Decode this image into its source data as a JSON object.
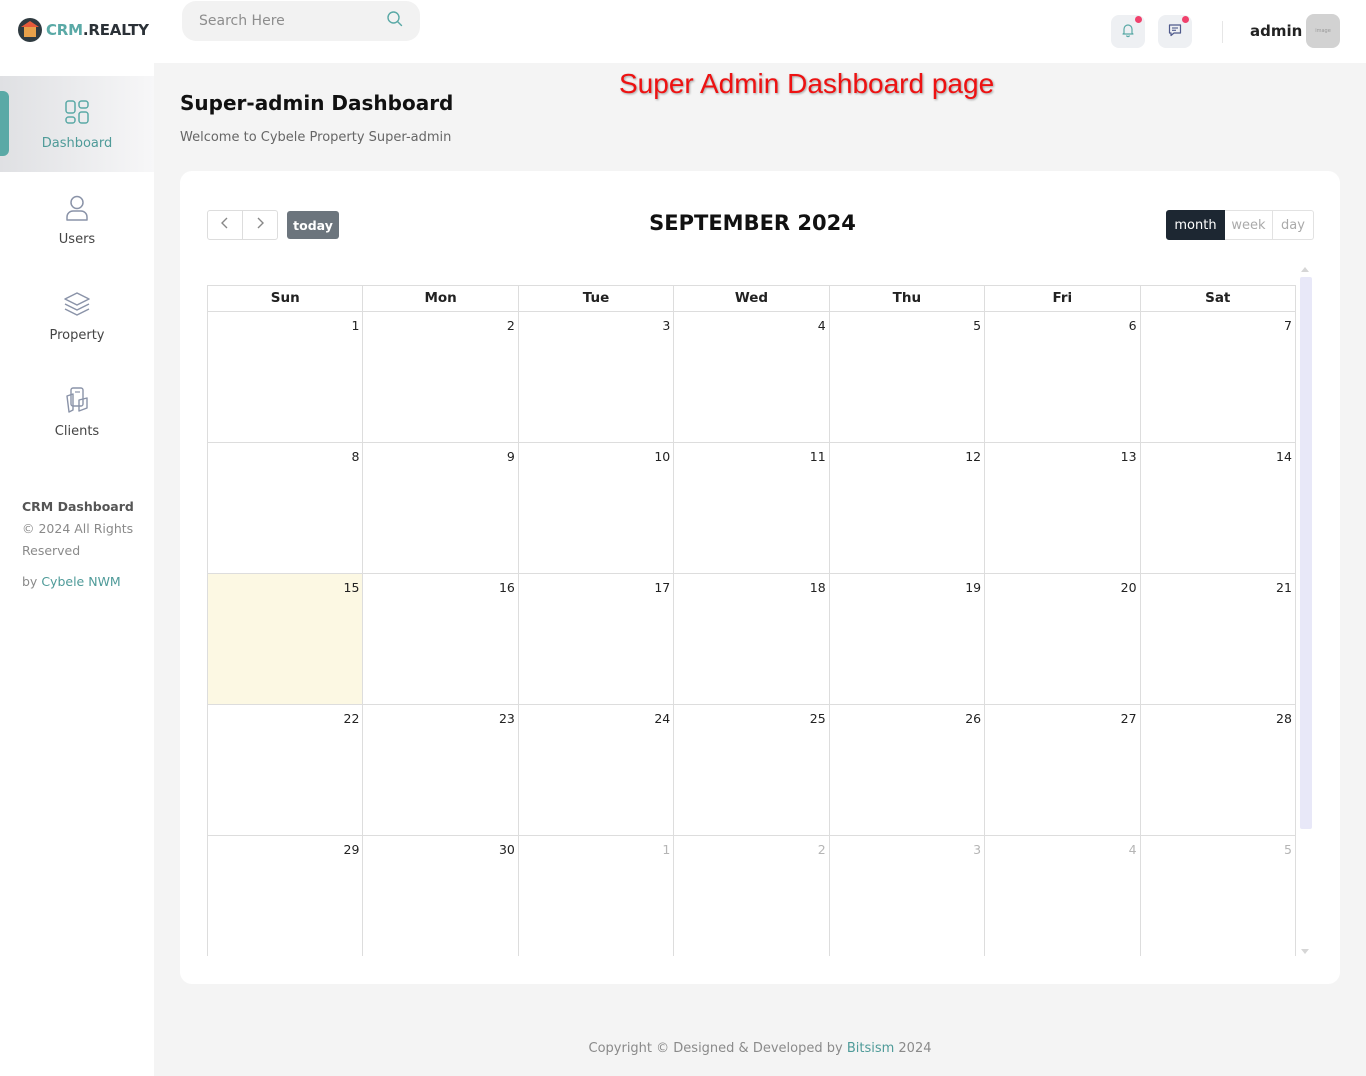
{
  "header": {
    "logo_prefix": "CRM",
    "logo_suffix": ".REALTY",
    "search_placeholder": "Search Here",
    "admin_name": "admin",
    "avatar_text": "image"
  },
  "sidebar": {
    "items": [
      {
        "label": "Dashboard",
        "icon": "dashboard-grid-icon",
        "active": true
      },
      {
        "label": "Users",
        "icon": "user-icon",
        "active": false
      },
      {
        "label": "Property",
        "icon": "layers-icon",
        "active": false
      },
      {
        "label": "Clients",
        "icon": "clients-icon",
        "active": false
      }
    ],
    "footer": {
      "brand": "CRM Dashboard",
      "rights": "© 2024 All Rights Reserved",
      "by_prefix": "by",
      "by_link": "Cybele NWM"
    }
  },
  "annotation": "Super Admin Dashboard page",
  "page": {
    "title": "Super-admin Dashboard",
    "subtitle": "Welcome to Cybele Property Super-admin"
  },
  "calendar": {
    "title": "SEPTEMBER 2024",
    "today_label": "today",
    "views": [
      "month",
      "week",
      "day"
    ],
    "active_view": "month",
    "weekdays": [
      "Sun",
      "Mon",
      "Tue",
      "Wed",
      "Thu",
      "Fri",
      "Sat"
    ],
    "weeks": [
      [
        "1",
        "2",
        "3",
        "4",
        "5",
        "6",
        "7"
      ],
      [
        "8",
        "9",
        "10",
        "11",
        "12",
        "13",
        "14"
      ],
      [
        "15",
        "16",
        "17",
        "18",
        "19",
        "20",
        "21"
      ],
      [
        "22",
        "23",
        "24",
        "25",
        "26",
        "27",
        "28"
      ],
      [
        "29",
        "30",
        "1",
        "2",
        "3",
        "4",
        "5"
      ]
    ],
    "today_date": "15",
    "colors": {
      "accent": "#5aa9a6",
      "today_bg": "#fcf8e3",
      "active_view_bg": "#1d2732",
      "badge": "#f0416c"
    }
  },
  "footer": {
    "prefix": "Copyright © Designed & Developed by",
    "link": "Bitsism",
    "year": "2024"
  }
}
